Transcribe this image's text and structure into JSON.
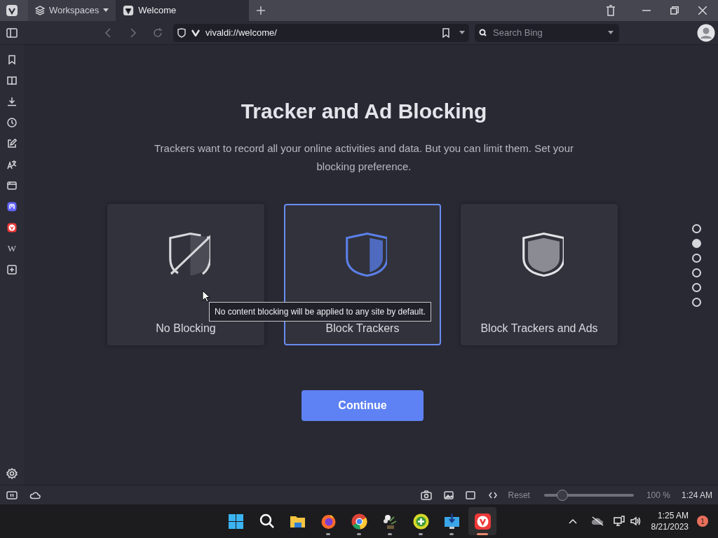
{
  "tabs": [
    {
      "label": "Workspaces",
      "kind": "workspaces",
      "selected": false
    },
    {
      "label": "Welcome",
      "kind": "page",
      "selected": true
    }
  ],
  "address_bar": {
    "url": "vivaldi://welcome/"
  },
  "search": {
    "placeholder": "Search Bing"
  },
  "sidebar": {
    "items": [
      {
        "kind": "bookmark"
      },
      {
        "kind": "reader"
      },
      {
        "kind": "download"
      },
      {
        "kind": "history"
      },
      {
        "kind": "notes"
      },
      {
        "kind": "translate"
      },
      {
        "kind": "window"
      },
      {
        "kind": "mastodon"
      },
      {
        "kind": "vivaldi"
      },
      {
        "kind": "wiki",
        "label": "W"
      },
      {
        "kind": "add"
      }
    ]
  },
  "page": {
    "title": "Tracker and Ad Blocking",
    "subtitle": "Trackers want to record all your online activities and data. But you can limit them. Set your blocking preference.",
    "options": [
      {
        "label": "No Blocking",
        "kind": "none",
        "selected": false
      },
      {
        "label": "Block Trackers",
        "kind": "trackers",
        "selected": true
      },
      {
        "label": "Block Trackers and Ads",
        "kind": "all",
        "selected": false
      }
    ],
    "continue_button": "Continue",
    "pager": [
      {
        "selected": false
      },
      {
        "selected": true
      },
      {
        "selected": false
      },
      {
        "selected": false
      },
      {
        "selected": false
      },
      {
        "selected": false
      }
    ],
    "tooltip": "No content blocking will be applied to any site by default."
  },
  "status_bar": {
    "reset": "Reset",
    "zoom": {
      "level": 0.2
    },
    "zoom_reading": "100 %",
    "clock": "1:24 AM"
  },
  "taskbar": {
    "apps": [
      {
        "kind": "start",
        "open": false,
        "active": false
      },
      {
        "kind": "search",
        "open": false,
        "active": false
      },
      {
        "kind": "folder",
        "open": false,
        "active": false
      },
      {
        "kind": "firefox",
        "open": true,
        "active": false
      },
      {
        "kind": "chrome",
        "open": true,
        "active": false
      },
      {
        "kind": "flower",
        "open": true,
        "active": false
      },
      {
        "kind": "plus",
        "open": true,
        "active": false
      },
      {
        "kind": "monitor",
        "open": true,
        "active": false
      },
      {
        "kind": "vivaldi",
        "open": true,
        "active": true
      }
    ],
    "time": "1:25 AM",
    "date": "8/21/2023",
    "notifications": "1"
  }
}
